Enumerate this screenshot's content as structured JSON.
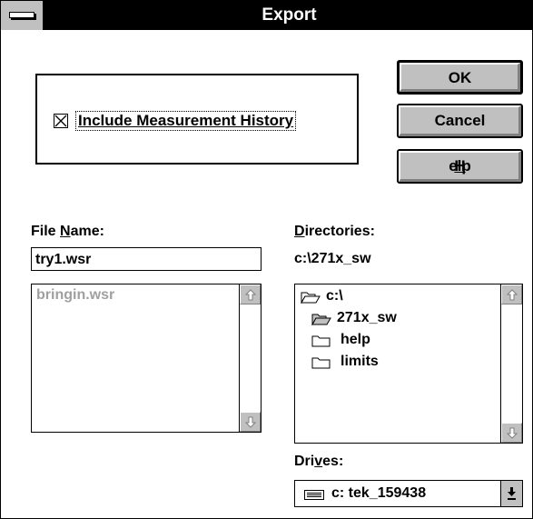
{
  "window": {
    "title": "Export"
  },
  "options": {
    "include_history_label": "Include Measurement History",
    "include_history_checked": true
  },
  "buttons": {
    "ok": "OK",
    "cancel": "Cancel",
    "help_pre": "",
    "help_u": "H",
    "help_post": "elp"
  },
  "file_name": {
    "label_pre": "File ",
    "label_u": "N",
    "label_post": "ame:",
    "value": "try1.wsr",
    "files": [
      "bringin.wsr"
    ]
  },
  "directories": {
    "label_u": "D",
    "label_post": "irectories:",
    "current_path": "c:\\271x_sw",
    "items": [
      {
        "name": "c:\\",
        "type": "open-folder"
      },
      {
        "name": "271x_sw",
        "type": "open-folder"
      },
      {
        "name": "help",
        "type": "closed-folder"
      },
      {
        "name": "limits",
        "type": "closed-folder"
      }
    ]
  },
  "drives": {
    "label_pre": "Dri",
    "label_u": "v",
    "label_post": "es:",
    "selected": "c: tek_159438"
  }
}
